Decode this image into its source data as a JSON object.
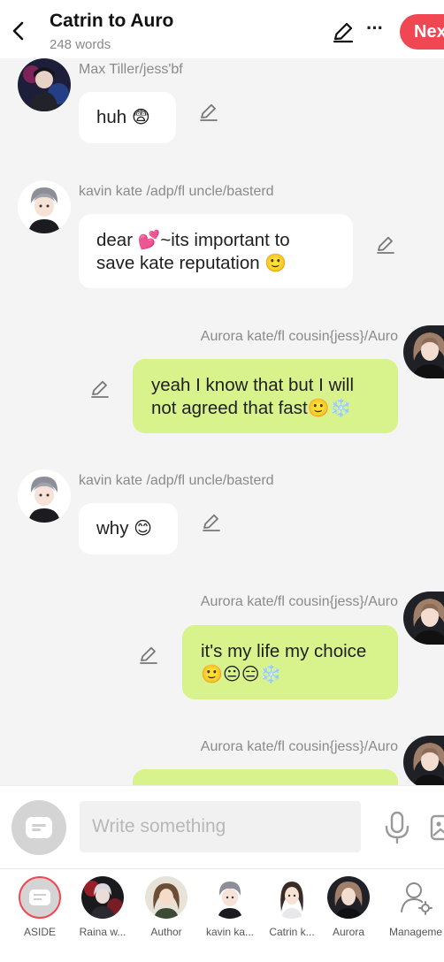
{
  "header": {
    "title": "Catrin to Auro",
    "word_count": "248 words",
    "next_label": "Next"
  },
  "messages": [
    {
      "side": "left",
      "sender": "Max Tiller/jess'bf",
      "text": "huh",
      "emoji": "😨"
    },
    {
      "side": "left",
      "sender": "kavin kate /adp/fl uncle/basterd",
      "text_line1": "dear 💕~its important to",
      "text_line2": "save kate reputation",
      "emoji": "🙂"
    },
    {
      "side": "right",
      "sender": "Aurora kate/fl cousin{jess}/Auro",
      "text_line1": "yeah I know that but I will",
      "text_line2": "not agreed that fast",
      "emoji": "🙂❄️"
    },
    {
      "side": "left",
      "sender": "kavin kate /adp/fl uncle/basterd",
      "text": "why",
      "emoji": "😊"
    },
    {
      "side": "right",
      "sender": "Aurora kate/fl cousin{jess}/Auro",
      "text": "it's my life my choice",
      "emoji": "🙂😐😑❄️"
    },
    {
      "side": "right",
      "sender": "Aurora kate/fl cousin{jess}/Auro",
      "text": ""
    }
  ],
  "composer": {
    "placeholder": "Write something"
  },
  "cast": [
    {
      "label": "ASIDE",
      "selected": true
    },
    {
      "label": "Raina w..."
    },
    {
      "label": "Author"
    },
    {
      "label": "kavin ka..."
    },
    {
      "label": "Catrin k..."
    },
    {
      "label": "Aurora"
    },
    {
      "label": "Manageme"
    }
  ],
  "colors": {
    "accent": "#f04752",
    "right_bubble": "#d8f28c",
    "left_bubble": "#ffffff",
    "background": "#f4f4f5"
  },
  "icons": [
    "back-arrow-icon",
    "pencil-icon",
    "more-icon",
    "edit-icon",
    "microphone-icon",
    "image-icon",
    "aside-icon",
    "manage-user-icon"
  ]
}
